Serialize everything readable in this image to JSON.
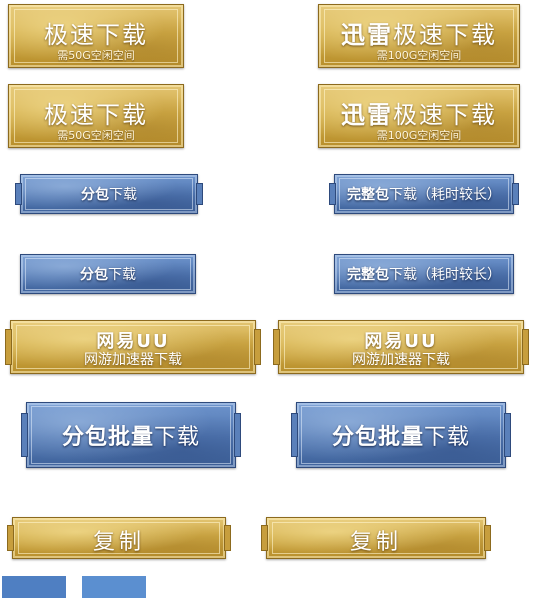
{
  "gold_buttons_row1": [
    {
      "title_bold": "",
      "title": "极速下载",
      "sub": "需50G空闲空间"
    },
    {
      "title_bold": "迅雷",
      "title": "极速下载",
      "sub": "需100G空闲空间"
    }
  ],
  "gold_buttons_row2": [
    {
      "title_bold": "",
      "title": "极速下载",
      "sub": "需50G空闲空间"
    },
    {
      "title_bold": "迅雷",
      "title": "极速下载",
      "sub": "需100G空闲空间"
    }
  ],
  "blue_row1": [
    {
      "bold": "分包",
      "text": "下载"
    },
    {
      "bold": "完整包",
      "text": "下载（耗时较长）"
    }
  ],
  "blue_row2": [
    {
      "bold": "分包",
      "text": "下载"
    },
    {
      "bold": "完整包",
      "text": "下载（耗时较长）"
    }
  ],
  "uu_buttons": [
    {
      "title": "网易UU",
      "sub": "网游加速器下载"
    },
    {
      "title": "网易UU",
      "sub": "网游加速器下载"
    }
  ],
  "batch_buttons": [
    {
      "bold": "分包批量",
      "text": "下载"
    },
    {
      "bold": "分包批量",
      "text": "下载"
    }
  ],
  "copy_buttons": [
    {
      "label": "复制"
    },
    {
      "label": "复制"
    }
  ],
  "swatches": [
    {
      "color": "#4f7fc2"
    },
    {
      "color": "#5b8fd0"
    }
  ]
}
